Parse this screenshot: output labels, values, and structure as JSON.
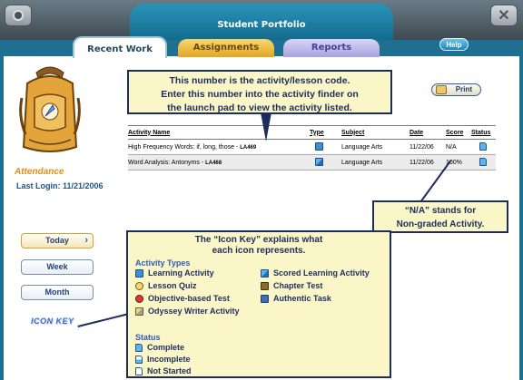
{
  "window": {
    "title": "Student Portfolio"
  },
  "tabs": [
    {
      "label": "Recent Work",
      "active": true
    },
    {
      "label": "Assignments",
      "active": false
    },
    {
      "label": "Reports",
      "active": false
    }
  ],
  "help_label": "Help",
  "sidebar": {
    "attendance_label": "Attendance",
    "last_login": "Last Login: 11/21/2006",
    "buttons": [
      "Today",
      "Week",
      "Month"
    ],
    "icon_key_label": "ICON KEY"
  },
  "print_label": "Print",
  "table": {
    "headers": [
      "Activity Name",
      "Type",
      "Subject",
      "Date",
      "Score",
      "Status"
    ],
    "rows": [
      {
        "name": "High Frequency Words: if, long, those - ",
        "code": "LA469",
        "type_icon": "learning-activity-icon",
        "subject": "Language Arts",
        "date": "11/22/06",
        "score": "N/A",
        "status_icon": "complete-icon"
      },
      {
        "name": "Word Analysis: Antonyms - ",
        "code": "LA468",
        "type_icon": "scored-learning-activity-icon",
        "subject": "Language Arts",
        "date": "11/22/06",
        "score": "100%",
        "status_icon": "complete-icon"
      }
    ]
  },
  "callouts": {
    "activity_code": [
      "This number is the activity/lesson code.",
      "Enter this number into the activity finder on",
      "the launch pad to view the activity listed."
    ],
    "na": [
      "“N/A” stands for",
      "Non-graded Activity."
    ],
    "icon_key": {
      "heading": [
        "The “Icon Key” explains what",
        "each icon represents."
      ],
      "activity_types_label": "Activity Types",
      "activity_types": [
        "Learning Activity",
        "Scored Learning Activity",
        "Lesson Quiz",
        "Chapter Test",
        "Objective-based Test",
        "Authentic Task",
        "Odyssey Writer Activity"
      ],
      "status_label": "Status",
      "status": [
        "Complete",
        "Incomplete",
        "Not Started"
      ]
    }
  },
  "colors": {
    "accent": "#1e6f92",
    "callout_bg": "#fbf6c8",
    "callout_border": "#1c2d5b"
  }
}
